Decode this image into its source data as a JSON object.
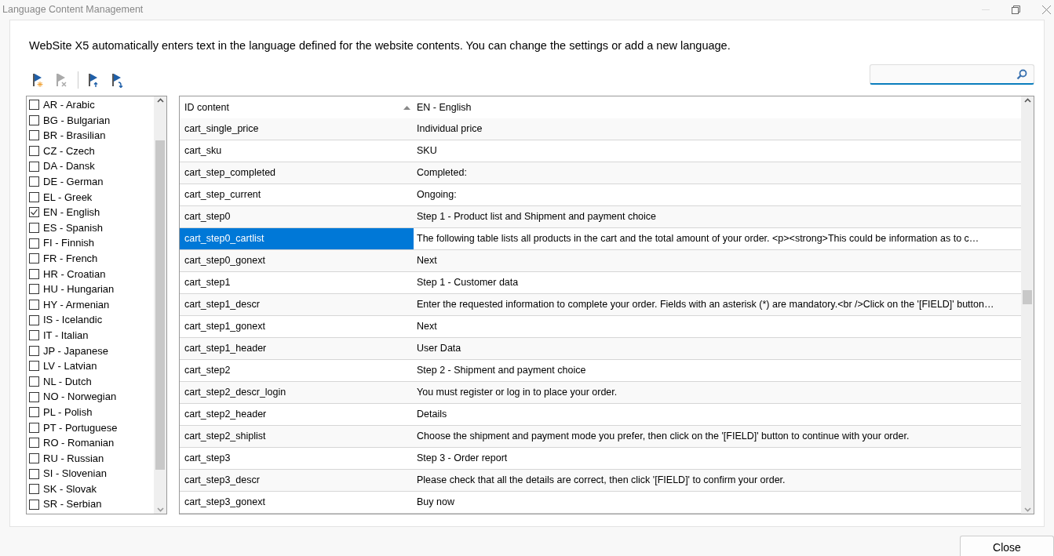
{
  "window": {
    "title": "Language Content Management"
  },
  "description": "WebSite X5 automatically enters text in the language defined for the website contents. You can change the settings or add a new language.",
  "toolbar": [
    {
      "kind": "add",
      "disabled": false
    },
    {
      "kind": "remove",
      "disabled": true
    },
    {
      "kind": "up",
      "disabled": false
    },
    {
      "kind": "down",
      "disabled": false
    }
  ],
  "languages": [
    {
      "label": "AR - Arabic",
      "checked": false
    },
    {
      "label": "BG - Bulgarian",
      "checked": false
    },
    {
      "label": "BR - Brasilian",
      "checked": false
    },
    {
      "label": "CZ - Czech",
      "checked": false
    },
    {
      "label": "DA - Dansk",
      "checked": false
    },
    {
      "label": "DE - German",
      "checked": false
    },
    {
      "label": "EL - Greek",
      "checked": false
    },
    {
      "label": "EN - English",
      "checked": true
    },
    {
      "label": "ES - Spanish",
      "checked": false
    },
    {
      "label": "FI - Finnish",
      "checked": false
    },
    {
      "label": "FR - French",
      "checked": false
    },
    {
      "label": "HR - Croatian",
      "checked": false
    },
    {
      "label": "HU - Hungarian",
      "checked": false
    },
    {
      "label": "HY - Armenian",
      "checked": false
    },
    {
      "label": "IS - Icelandic",
      "checked": false
    },
    {
      "label": "IT - Italian",
      "checked": false
    },
    {
      "label": "JP - Japanese",
      "checked": false
    },
    {
      "label": "LV - Latvian",
      "checked": false
    },
    {
      "label": "NL - Dutch",
      "checked": false
    },
    {
      "label": "NO - Norwegian",
      "checked": false
    },
    {
      "label": "PL - Polish",
      "checked": false
    },
    {
      "label": "PT - Portuguese",
      "checked": false
    },
    {
      "label": "RO - Romanian",
      "checked": false
    },
    {
      "label": "RU - Russian",
      "checked": false
    },
    {
      "label": "SI - Slovenian",
      "checked": false
    },
    {
      "label": "SK - Slovak",
      "checked": false
    },
    {
      "label": "SR - Serbian",
      "checked": false
    }
  ],
  "table": {
    "columns": [
      "ID content",
      "EN - English"
    ],
    "rows": [
      {
        "id": "cart_single_price",
        "text": "Individual price",
        "selected": false
      },
      {
        "id": "cart_sku",
        "text": "SKU",
        "selected": false
      },
      {
        "id": "cart_step_completed",
        "text": "Completed:",
        "selected": false
      },
      {
        "id": "cart_step_current",
        "text": "Ongoing:",
        "selected": false
      },
      {
        "id": "cart_step0",
        "text": "Step 1 - Product list and Shipment and payment choice",
        "selected": false
      },
      {
        "id": "cart_step0_cartlist",
        "text": "The following table lists all products in the cart and the total amount of your order. <p><strong>This could be information as to c…",
        "selected": true
      },
      {
        "id": "cart_step0_gonext",
        "text": "Next",
        "selected": false
      },
      {
        "id": "cart_step1",
        "text": "Step 1 - Customer data",
        "selected": false
      },
      {
        "id": "cart_step1_descr",
        "text": "Enter the requested information to complete your order. Fields with an asterisk (*) are mandatory.<br />Click on the '[FIELD]' button…",
        "selected": false
      },
      {
        "id": "cart_step1_gonext",
        "text": "Next",
        "selected": false
      },
      {
        "id": "cart_step1_header",
        "text": "User Data",
        "selected": false
      },
      {
        "id": "cart_step2",
        "text": "Step 2 - Shipment and payment choice",
        "selected": false
      },
      {
        "id": "cart_step2_descr_login",
        "text": "You must register or log in to place your order.",
        "selected": false
      },
      {
        "id": "cart_step2_header",
        "text": "Details",
        "selected": false
      },
      {
        "id": "cart_step2_shiplist",
        "text": "Choose the shipment and payment mode you prefer, then click on the '[FIELD]' button to continue with your order.",
        "selected": false
      },
      {
        "id": "cart_step3",
        "text": "Step 3 - Order report",
        "selected": false
      },
      {
        "id": "cart_step3_descr",
        "text": "Please check that all the details are correct, then click '[FIELD]' to confirm your order.",
        "selected": false
      },
      {
        "id": "cart_step3_gonext",
        "text": "Buy now",
        "selected": false
      }
    ]
  },
  "buttons": [
    {
      "label": "Close"
    }
  ]
}
